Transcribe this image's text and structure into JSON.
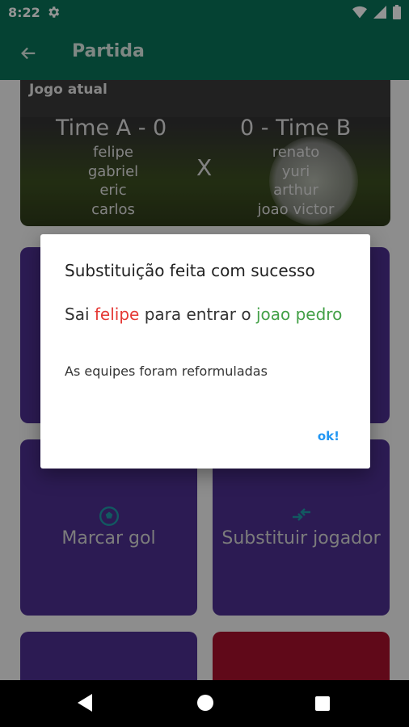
{
  "status": {
    "time": "8:22"
  },
  "app_bar": {
    "title": "Partida"
  },
  "match": {
    "label": "Jogo atual",
    "team_a": {
      "title": "Time A - 0",
      "players": [
        "felipe",
        "gabriel",
        "eric",
        "carlos"
      ]
    },
    "vs": "X",
    "team_b": {
      "title": "0 - Time B",
      "players": [
        "renato",
        "yuri",
        "arthur",
        "joao victor"
      ]
    }
  },
  "tiles": {
    "goal": {
      "label": "Marcar gol",
      "icon": "soccer-ball-icon"
    },
    "substitute": {
      "label": "Substituir jogador",
      "icon": "swap-arrows-icon"
    }
  },
  "dialog": {
    "title": "Substituição feita com sucesso",
    "line_prefix": "Sai ",
    "player_out": "felipe",
    "line_middle": " para entrar o ",
    "player_in": "joao pedro",
    "note": "As equipes foram reformuladas",
    "ok_label": "ok!"
  },
  "colors": {
    "primary": "#0a7358",
    "tile_purple": "#4c2f8f",
    "tile_red": "#a5112c",
    "out_red": "#e53935",
    "in_green": "#43a047",
    "accent_blue": "#2196f3"
  }
}
